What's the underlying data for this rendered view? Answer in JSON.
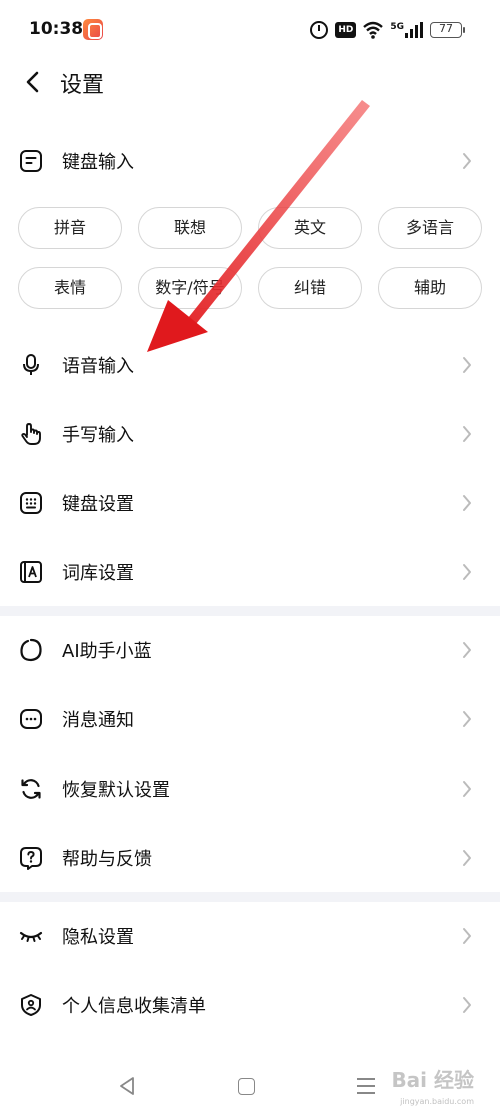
{
  "status_bar": {
    "time": "10:38",
    "hd": "HD",
    "network": "5G",
    "battery": "77"
  },
  "header": {
    "title": "设置"
  },
  "keyboard_input": {
    "label": "键盘输入",
    "chips": [
      "拼音",
      "联想",
      "英文",
      "多语言",
      "表情",
      "数字/符号",
      "纠错",
      "辅助"
    ]
  },
  "section1": [
    {
      "label": "语音输入",
      "icon": "microphone-icon"
    },
    {
      "label": "手写输入",
      "icon": "hand-pointer-icon"
    },
    {
      "label": "键盘设置",
      "icon": "keyboard-icon"
    },
    {
      "label": "词库设置",
      "icon": "dictionary-icon"
    }
  ],
  "section2": [
    {
      "label": "AI助手小蓝",
      "icon": "ai-assistant-icon"
    },
    {
      "label": "消息通知",
      "icon": "message-icon"
    },
    {
      "label": "恢复默认设置",
      "icon": "reset-icon"
    },
    {
      "label": "帮助与反馈",
      "icon": "help-icon"
    }
  ],
  "section3": [
    {
      "label": "隐私设置",
      "icon": "eye-closed-icon"
    },
    {
      "label": "个人信息收集清单",
      "icon": "shield-icon"
    }
  ],
  "watermark": {
    "text": "Bai 经验",
    "sub": "jingyan.baidu.com"
  },
  "colors": {
    "annotation_arrow": "#e0191d",
    "divider": "#f2f3f7",
    "chip_border": "#d6d6d6"
  }
}
